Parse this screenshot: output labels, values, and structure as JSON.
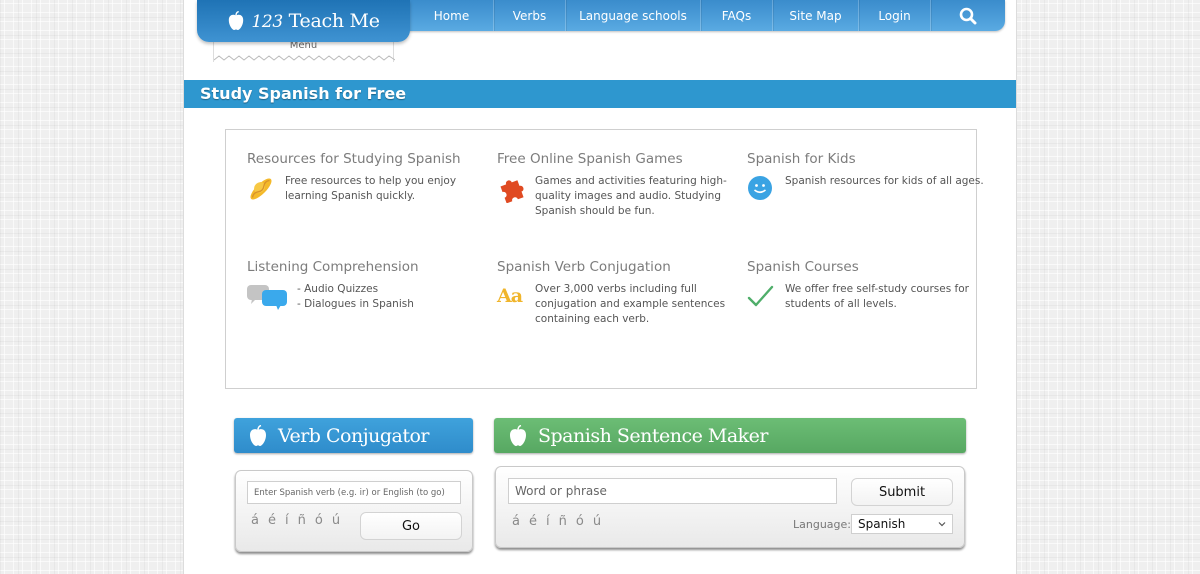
{
  "brand": {
    "logo_number": "123",
    "logo_text": "Teach Me",
    "menu_label": "Menu"
  },
  "nav": {
    "items": [
      {
        "label": "Home"
      },
      {
        "label": "Verbs"
      },
      {
        "label": "Language schools"
      },
      {
        "label": "FAQs"
      },
      {
        "label": "Site Map"
      },
      {
        "label": "Login"
      }
    ],
    "search_icon": "search-icon"
  },
  "page_title": "Study Spanish for Free",
  "features": [
    {
      "title": "Resources for Studying Spanish",
      "icon": "sombrero-icon",
      "description": "Free resources to help you enjoy learning Spanish quickly."
    },
    {
      "title": "Free Online Spanish Games",
      "icon": "puzzle-piece-icon",
      "description": "Games and activities featuring high-quality images and audio. Studying Spanish should be fun."
    },
    {
      "title": "Spanish for Kids",
      "icon": "smiley-face-icon",
      "description": "Spanish resources for kids of all ages."
    },
    {
      "title": "Listening Comprehension",
      "icon": "speech-bubbles-icon",
      "description_lines": [
        "- Audio Quizzes",
        "- Dialogues in Spanish"
      ]
    },
    {
      "title": "Spanish Verb Conjugation",
      "icon": "text-aa-icon",
      "icon_text": "Aa",
      "description": "Over 3,000 verbs including full conjugation and example sentences containing each verb."
    },
    {
      "title": "Spanish Courses",
      "icon": "checkmark-icon",
      "description": "We offer free self-study courses for students of all levels."
    }
  ],
  "verb_conjugator": {
    "title": "Verb Conjugator",
    "input_placeholder": "Enter Spanish verb (e.g. ir) or English (to go)",
    "input_value": "",
    "accents": [
      "á",
      "é",
      "í",
      "ñ",
      "ó",
      "ú"
    ],
    "go_label": "Go"
  },
  "sentence_maker": {
    "title": "Spanish Sentence Maker",
    "input_placeholder": "Word or phrase",
    "input_value": "",
    "accents": [
      "á",
      "é",
      "í",
      "ñ",
      "ó",
      "ú"
    ],
    "submit_label": "Submit",
    "language_label": "Language:",
    "language_selected": "Spanish"
  },
  "colors": {
    "brand_blue": "#2e97cf",
    "nav_blue": "#3a8ccc",
    "sentence_green": "#5fb06a",
    "verb_blue": "#3596d2"
  }
}
